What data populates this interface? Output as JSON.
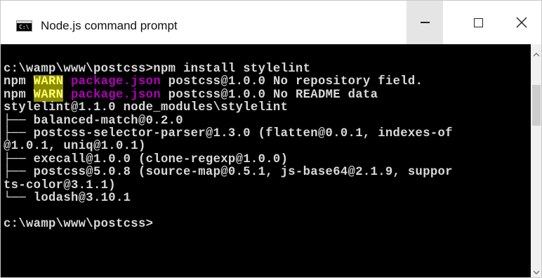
{
  "window": {
    "title": "Node.js command prompt",
    "icon": "command-prompt-icon",
    "icon_text": "C:\\"
  },
  "console": {
    "lines": [
      "c:\\wamp\\www\\postcss>npm install stylelint",
      "npm WARN package.json postcss@1.0.0 No repository field.",
      "npm WARN package.json postcss@1.0.0 No README data",
      "stylelint@1.1.0 node_modules\\stylelint",
      "├── balanced-match@0.2.0",
      "├── postcss-selector-parser@1.3.0 (flatten@0.0.1, indexes-of",
      "@1.0.1, uniq@1.0.1)",
      "├── execall@1.0.0 (clone-regexp@1.0.0)",
      "├── postcss@5.0.8 (source-map@0.5.1, js-base64@2.1.9, suppor",
      "ts-color@3.1.1)",
      "└── lodash@3.10.1",
      "",
      "c:\\wamp\\www\\postcss>"
    ],
    "colors": {
      "background": "#000000",
      "text": "#d9d9d9",
      "warn_bg": "#8a8a00",
      "warn_fg": "#ffff66",
      "package_json": "#b000b8"
    }
  }
}
